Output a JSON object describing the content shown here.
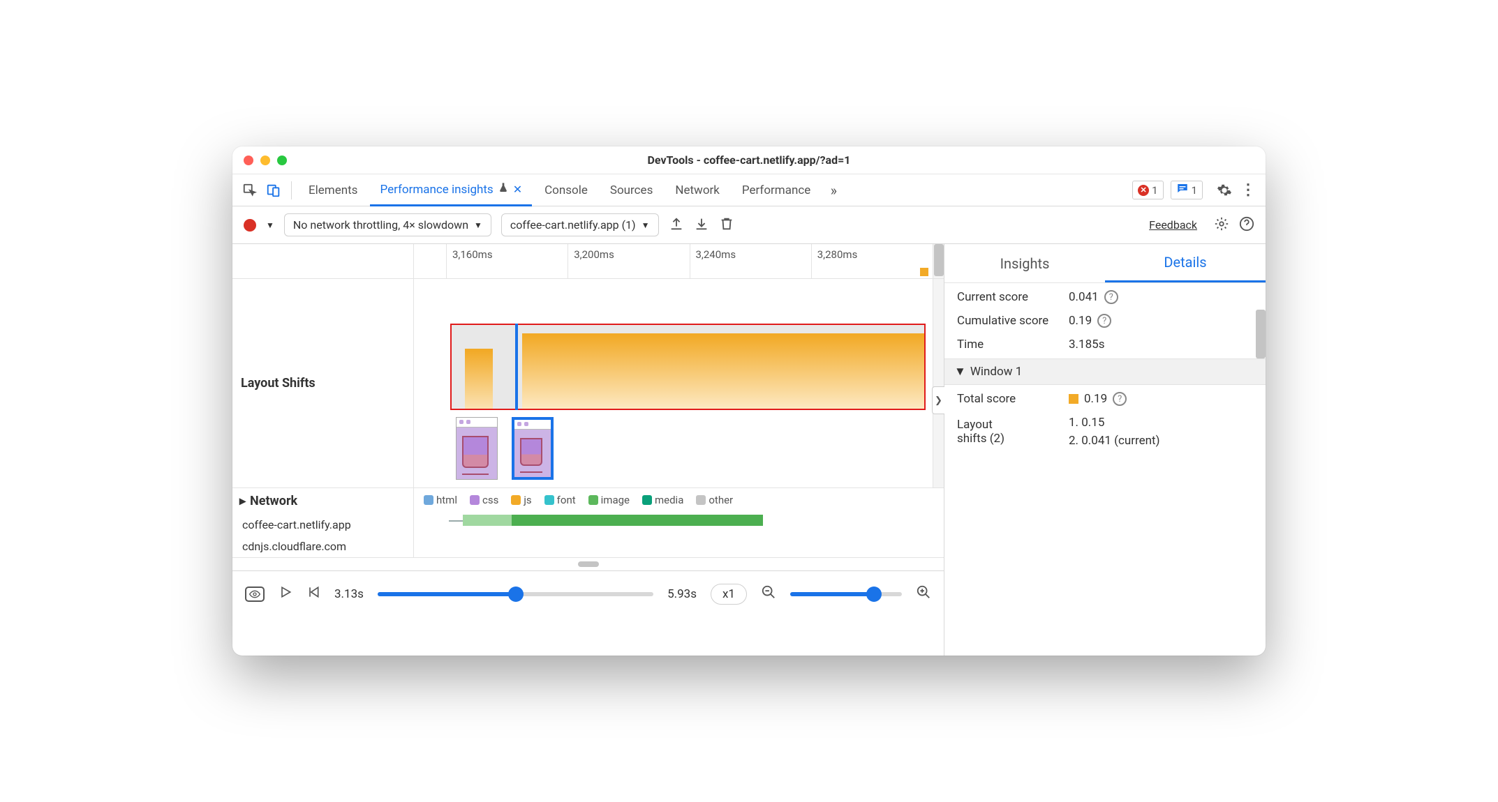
{
  "window": {
    "title": "DevTools - coffee-cart.netlify.app/?ad=1"
  },
  "tabs": {
    "elements": "Elements",
    "perf_insights": "Performance insights",
    "console": "Console",
    "sources": "Sources",
    "network": "Network",
    "performance": "Performance"
  },
  "badges": {
    "errors": "1",
    "messages": "1"
  },
  "toolbar": {
    "throttling": "No network throttling, 4× slowdown",
    "trace": "coffee-cart.netlify.app (1)",
    "feedback": "Feedback"
  },
  "ruler": {
    "t0": "3,160ms",
    "t1": "3,200ms",
    "t2": "3,240ms",
    "t3": "3,280ms"
  },
  "layout_shifts_label": "Layout Shifts",
  "network": {
    "label": "Network",
    "hosts": [
      "coffee-cart.netlify.app",
      "cdnjs.cloudflare.com"
    ],
    "legend": {
      "html": "html",
      "css": "css",
      "js": "js",
      "font": "font",
      "image": "image",
      "media": "media",
      "other": "other"
    }
  },
  "playback": {
    "start": "3.13s",
    "end": "5.93s",
    "speed": "x1"
  },
  "rightpane": {
    "tabs": {
      "insights": "Insights",
      "details": "Details"
    },
    "current_score_lbl": "Current score",
    "current_score_val": "0.041",
    "cumulative_score_lbl": "Cumulative score",
    "cumulative_score_val": "0.19",
    "time_lbl": "Time",
    "time_val": "3.185s",
    "window_hdr": "Window 1",
    "total_score_lbl": "Total score",
    "total_score_val": "0.19",
    "ls_lbl_top": "Layout",
    "ls_lbl_bottom": "shifts (2)",
    "ls_1": "1. 0.15",
    "ls_2": "2. 0.041 (current)"
  }
}
